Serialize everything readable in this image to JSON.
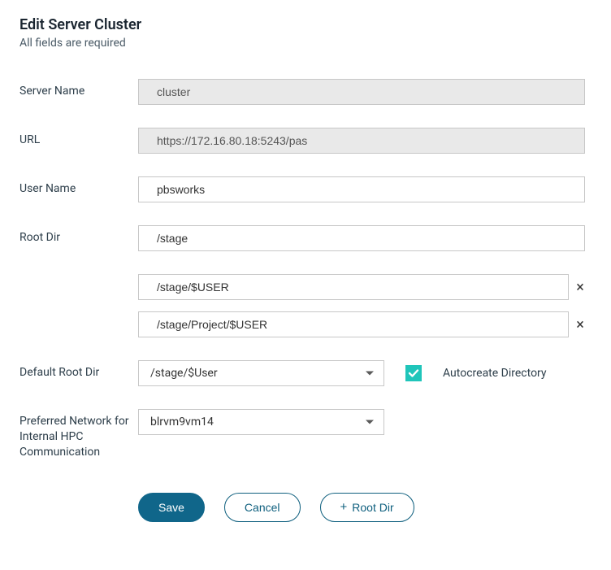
{
  "header": {
    "title": "Edit Server Cluster",
    "subtitle": "All fields are required"
  },
  "labels": {
    "server_name": "Server Name",
    "url": "URL",
    "user_name": "User Name",
    "root_dir": "Root Dir",
    "default_root_dir": "Default Root Dir",
    "autocreate": "Autocreate Directory",
    "preferred_network": "Preferred Network for Internal HPC Communication"
  },
  "values": {
    "server_name": "cluster",
    "url": "https://172.16.80.18:5243/pas",
    "user_name": "pbsworks",
    "root_dir": "/stage",
    "extra_root_dirs": [
      "/stage/$USER",
      "/stage/Project/$USER"
    ],
    "default_root_dir": "/stage/$User",
    "autocreate_checked": true,
    "preferred_network": "blrvm9vm14"
  },
  "buttons": {
    "save": "Save",
    "cancel": "Cancel",
    "add_root_dir": "Root Dir"
  }
}
